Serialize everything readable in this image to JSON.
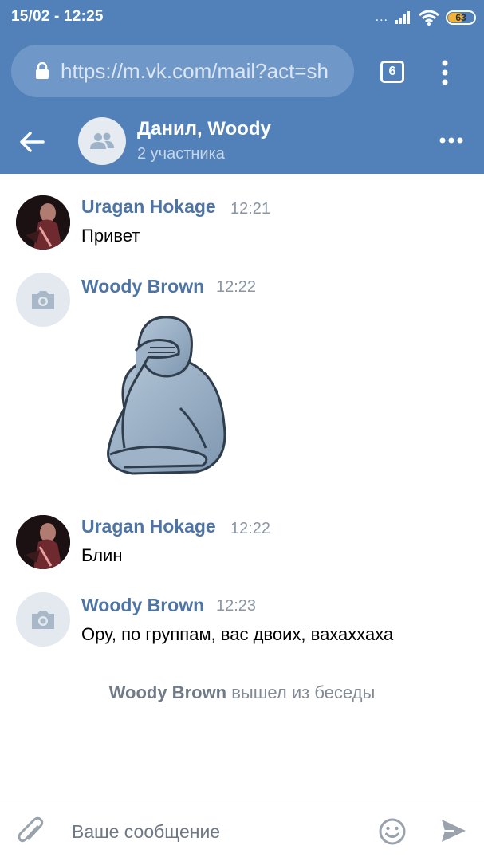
{
  "status_bar": {
    "time": "15/02 - 12:25",
    "dots": "...",
    "battery": "63",
    "battery_level": 0.63
  },
  "browser": {
    "url": "https://m.vk.com/mail?act=sh",
    "tabs_count": "6"
  },
  "chat_header": {
    "title": "Данил, Woody",
    "subtitle": "2 участника"
  },
  "messages": [
    {
      "author": "Uragan Hokage",
      "time": "12:21",
      "text": "Привет",
      "avatar": "photo"
    },
    {
      "author": "Woody Brown",
      "time": "12:22",
      "text": "",
      "avatar": "camera-icon",
      "attachment": "sticker"
    },
    {
      "author": "Uragan Hokage",
      "time": "12:22",
      "text": "Блин",
      "avatar": "photo"
    },
    {
      "author": "Woody Brown",
      "time": "12:23",
      "text": "Ору, по группам, вас двоих, вахаххаха",
      "avatar": "camera-icon"
    }
  ],
  "service_message": {
    "actor": "Woody Brown",
    "action": " вышел из беседы"
  },
  "composer": {
    "placeholder": "Ваше сообщение"
  },
  "colors": {
    "header": "#5181b8",
    "author": "#4d74a4",
    "battery": "#f0b43c"
  }
}
